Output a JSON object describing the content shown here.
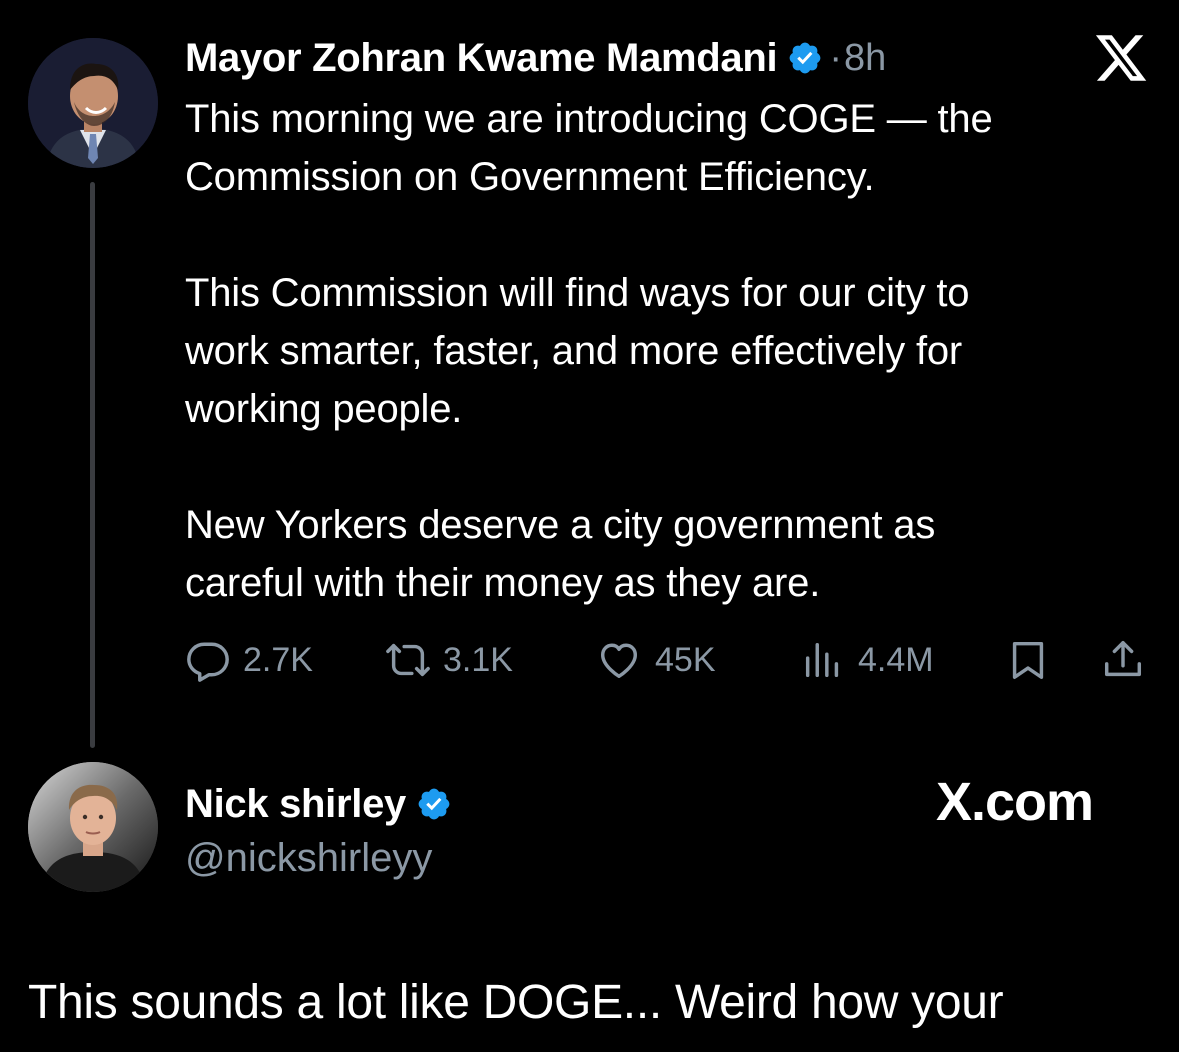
{
  "original_post": {
    "display_name": "Mayor Zohran Kwame Mamdani",
    "verified": true,
    "time_separator": "·",
    "time": "8h",
    "platform_logo": "x-logo",
    "text": "This morning we are introducing COGE — the\nCommission on Government Efficiency.\n\nThis Commission will find ways for our city to\nwork smarter, faster, and more effectively for\nworking people.\n\nNew Yorkers deserve a city government as\ncareful with their money as they are.",
    "metrics": {
      "replies": "2.7K",
      "reposts": "3.1K",
      "likes": "45K",
      "views": "4.4M"
    }
  },
  "reply_post": {
    "display_name": "Nick shirley",
    "verified": true,
    "handle": "@nickshirleyy",
    "brand_label": "X.com",
    "text": "This sounds a lot like DOGE... Weird how your"
  },
  "colors": {
    "background": "#000000",
    "text_primary": "#ffffff",
    "text_secondary": "#8b98a5",
    "verified_blue": "#1d9bf0",
    "thread_line": "#3a3c40"
  }
}
